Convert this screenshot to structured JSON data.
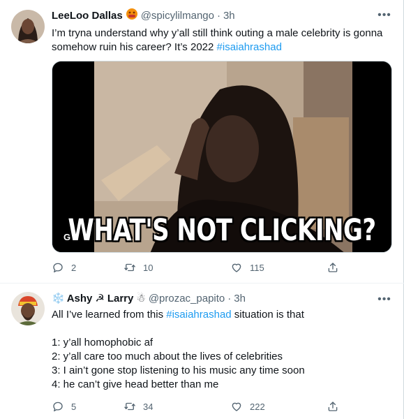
{
  "tweets": [
    {
      "display_name": "LeeLoo Dallas",
      "handle": "@spicylilmango",
      "separator": "·",
      "time": "3h",
      "more": "•••",
      "text_line1": "I’m tryna understand why y’all still think outing a male celebrity is gonna",
      "text_line2_plain": "somehow ruin his career? It’s 2022 ",
      "hashtag": "#isaiahrashad",
      "media": {
        "badge": "GIF",
        "caption": "WHAT'S NOT CLICKING?"
      },
      "replies": "2",
      "retweets": "10",
      "likes": "115"
    },
    {
      "display_name_prefix": "❄️",
      "display_name": "Ashy",
      "display_name_mid": "☭",
      "display_name_2": "Larry",
      "display_name_suffix": "☃",
      "handle": "@prozac_papito",
      "separator": "·",
      "time": "3h",
      "more": "•••",
      "line1_plain": "All I’ve learned from this ",
      "hashtag": "#isaiahrashad",
      "line1_end": " situation is that",
      "list": [
        "1: y’all homophobic af",
        "2: y’all care too much about the lives of celebrities",
        "3: I ain’t gone stop listening to his music any time soon",
        "4: he can’t give head better than me"
      ],
      "replies": "5",
      "retweets": "34",
      "likes": "222"
    }
  ]
}
